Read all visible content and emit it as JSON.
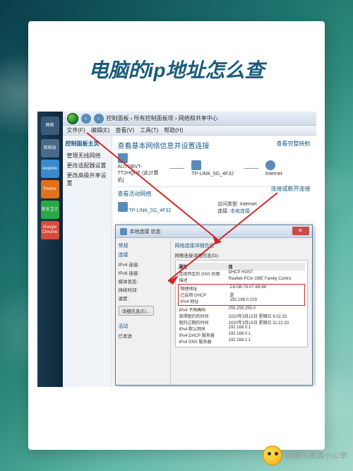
{
  "page_title": "电脑的ip地址怎么查",
  "taskbar": {
    "items": [
      {
        "name": "recycle-bin",
        "label": "回收站",
        "color": "#4a6a8a"
      },
      {
        "name": "iexplore",
        "label": "iexplore",
        "color": "#3a8ad0"
      },
      {
        "name": "firefox",
        "label": "Firefox",
        "color": "#e0701a"
      },
      {
        "name": "security",
        "label": "安全卫士",
        "color": "#2aa84a"
      },
      {
        "name": "chrome",
        "label": "Google Chrome",
        "color": "#d84a3a"
      }
    ],
    "top_label": "网络"
  },
  "window": {
    "breadcrumb": "控制面板 › 所有控制面板项 › 网络和共享中心",
    "menu": [
      "文件(F)",
      "编辑(E)",
      "查看(V)",
      "工具(T)",
      "帮助(H)"
    ],
    "sidebar_header": "控制面板主页",
    "sidebar_items": [
      "管理无线网络",
      "更改适配器设置",
      "更改高级共享设置"
    ],
    "main_title": "查看基本网络信息并设置连接",
    "full_map_link": "查看完整映射",
    "network_row": {
      "pc": "AUTOBVT-TT2HQHE (此计算机)",
      "net1": "TP-LINK_5G_4F32",
      "net2": "Internet"
    },
    "active_title": "查看活动网络",
    "connect_link": "连接或断开连接",
    "active_net": "TP-LINK_5G_4F32",
    "access_type_label": "访问类型:",
    "access_type_value": "Internet",
    "connection_label": "连接:",
    "connection_value": "本地连接"
  },
  "dialog": {
    "title": "本地连接 状态",
    "tab": "常规",
    "section_conn": "连接",
    "rows_left": [
      "IPv4 连接:",
      "IPv6 连接:",
      "媒体状态:",
      "持续时间:",
      "速度:"
    ],
    "details_btn": "详细信息(E)...",
    "activity_label": "活动",
    "sent_label": "已发送",
    "detail_title": "网络连接详细信息",
    "detail_subtitle": "网络连接详细信息(D):",
    "col_prop": "属性",
    "col_val": "值",
    "rows": [
      {
        "k": "连接特定的 DNS 后缀",
        "v": "DHCP HOST"
      },
      {
        "k": "描述",
        "v": "Realtek PCIe GBE Family Contro"
      },
      {
        "k": "物理地址",
        "v": "C8-5B-76-07-68-86",
        "hl": true
      },
      {
        "k": "已启用 DHCP",
        "v": "是",
        "hl": true
      },
      {
        "k": "IPv4 地址",
        "v": "192.168.0.103",
        "hl": true
      },
      {
        "k": "IPv4 子网掩码",
        "v": "255.255.255.0"
      },
      {
        "k": "获得租约的时间",
        "v": "2020年3月15日 星期日 9:02:33"
      },
      {
        "k": "租约过期的时间",
        "v": "2020年3月15日 星期日 11:22:33"
      },
      {
        "k": "IPv4 默认网关",
        "v": "192.168.0.1"
      },
      {
        "k": "IPv4 DHCP 服务器",
        "v": "192.168.0.1"
      },
      {
        "k": "IPv4 DNS 服务器",
        "v": "192.168.1.1"
      }
    ]
  },
  "watermark": "@通川高清小公举"
}
